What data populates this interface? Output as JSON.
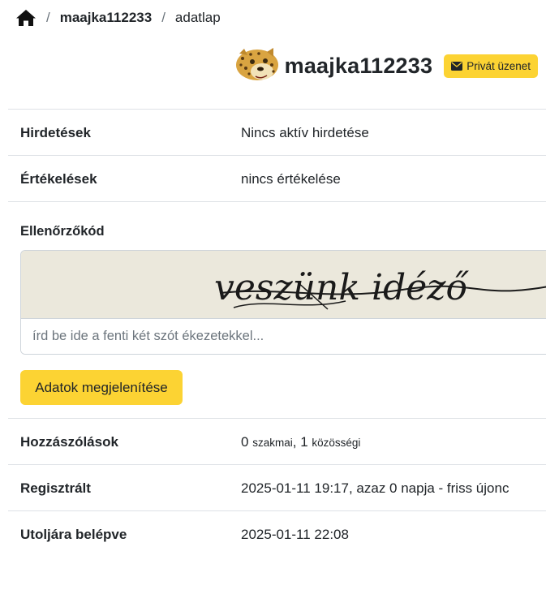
{
  "breadcrumb": {
    "user": "maajka112233",
    "current": "adatlap"
  },
  "profile": {
    "username": "maajka112233",
    "pm_label": "Privát üzenet"
  },
  "rows_top": [
    {
      "label": "Hirdetések",
      "value": "Nincs aktív hirdetése"
    },
    {
      "label": "Értékelések",
      "value": "nincs értékelése"
    }
  ],
  "captcha": {
    "label": "Ellenőrzőkód",
    "placeholder": "írd be ide a fenti két szót ékezetekkel...",
    "image_text": "veszünk idéző",
    "button_label": "Adatok megjelenítése"
  },
  "comments": {
    "label": "Hozzászólások",
    "pro_count": "0",
    "pro_word": "szakmai",
    "sep": ",",
    "community_count": "1",
    "community_word": "közösségi"
  },
  "rows_bottom": [
    {
      "label": "Regisztrált",
      "value": "2025-01-11 19:17, azaz 0 napja - friss újonc"
    },
    {
      "label": "Utoljára belépve",
      "value": "2025-01-11 22:08"
    }
  ],
  "colors": {
    "accent": "#fcd333",
    "border": "#dee2e6",
    "captcha_bg": "#ebe8dc"
  }
}
